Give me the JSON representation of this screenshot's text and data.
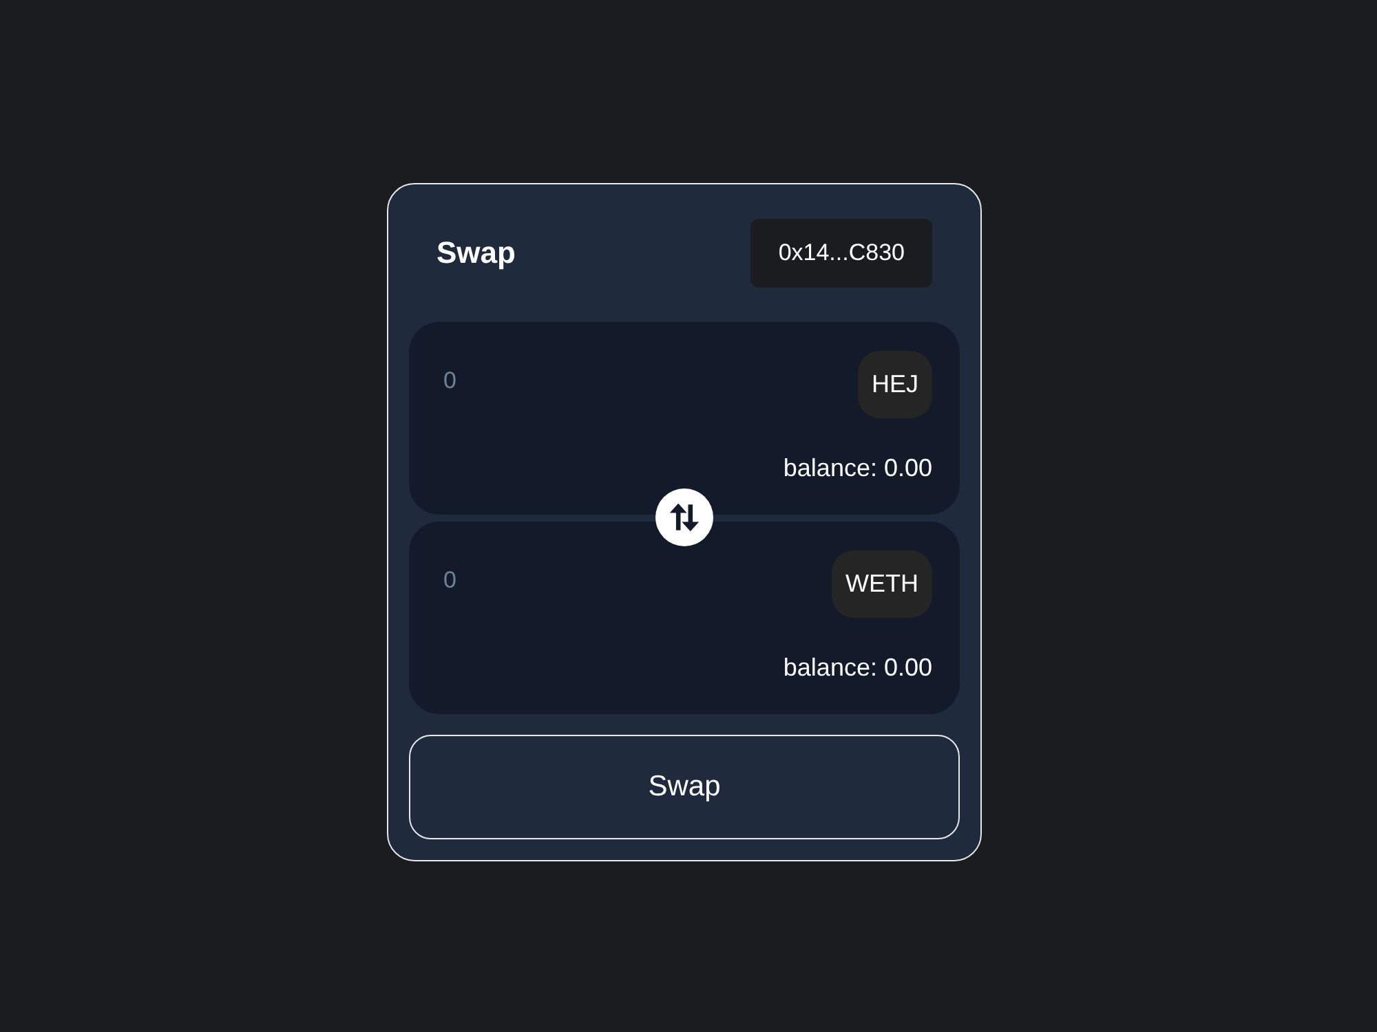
{
  "header": {
    "title": "Swap",
    "account": "0x14...C830"
  },
  "panels": [
    {
      "amount": {
        "placeholder": "0"
      },
      "token": "HEJ",
      "balance": "balance: 0.00"
    },
    {
      "amount": {
        "placeholder": "0"
      },
      "token": "WETH",
      "balance": "balance: 0.00"
    }
  ],
  "swap_button": {
    "label": "Swap"
  }
}
